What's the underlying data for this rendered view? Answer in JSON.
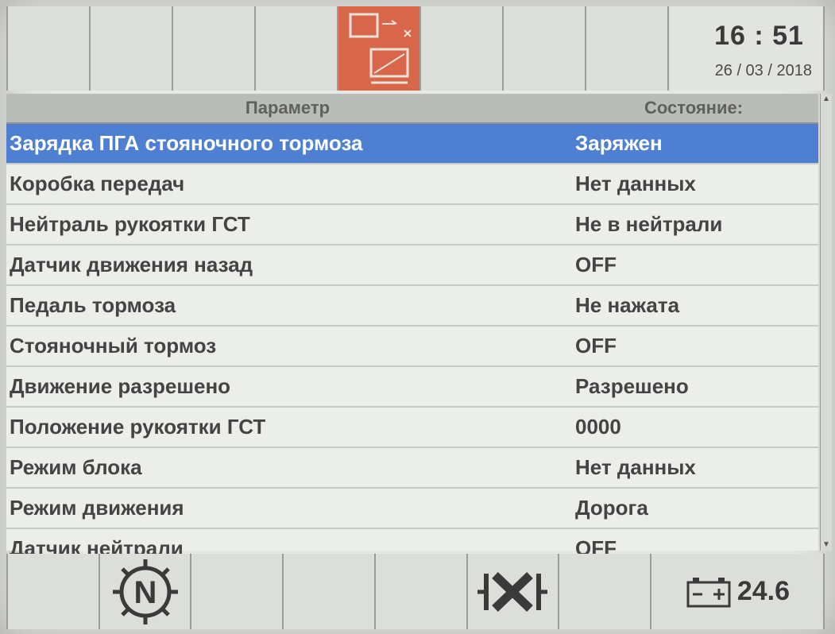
{
  "status": {
    "time": "16 : 51",
    "date": "26 / 03 / 2018"
  },
  "top_toolbar": {
    "active_icon": "screen-transfer-icon",
    "accent_color": "#d8664b"
  },
  "table": {
    "columns": [
      "Параметр",
      "Состояние:"
    ],
    "rows": [
      {
        "param": "Зарядка ПГА стояночного тормоза",
        "state": "Заряжен"
      },
      {
        "param": "Коробка передач",
        "state": "Нет данных"
      },
      {
        "param": "Нейтраль рукоятки ГСТ",
        "state": "Не в нейтрали"
      },
      {
        "param": "Датчик движения назад",
        "state": "OFF"
      },
      {
        "param": "Педаль тормоза",
        "state": "Не нажата"
      },
      {
        "param": "Стояночный тормоз",
        "state": "OFF"
      },
      {
        "param": "Движение разрешено",
        "state": "Разрешено"
      },
      {
        "param": "Положение рукоятки ГСТ",
        "state": "0000"
      },
      {
        "param": "Режим блока",
        "state": "Нет данных"
      },
      {
        "param": "Режим движения",
        "state": "Дорога"
      },
      {
        "param": "Датчик нейтрали",
        "state": "OFF"
      }
    ],
    "selected_color": "#4f7fd0"
  },
  "bottom_toolbar": {
    "neutral_letter": "N",
    "battery_voltage": "24.6",
    "icons": [
      "neutral-gear-icon",
      "transmission-x-icon",
      "battery-icon"
    ]
  }
}
